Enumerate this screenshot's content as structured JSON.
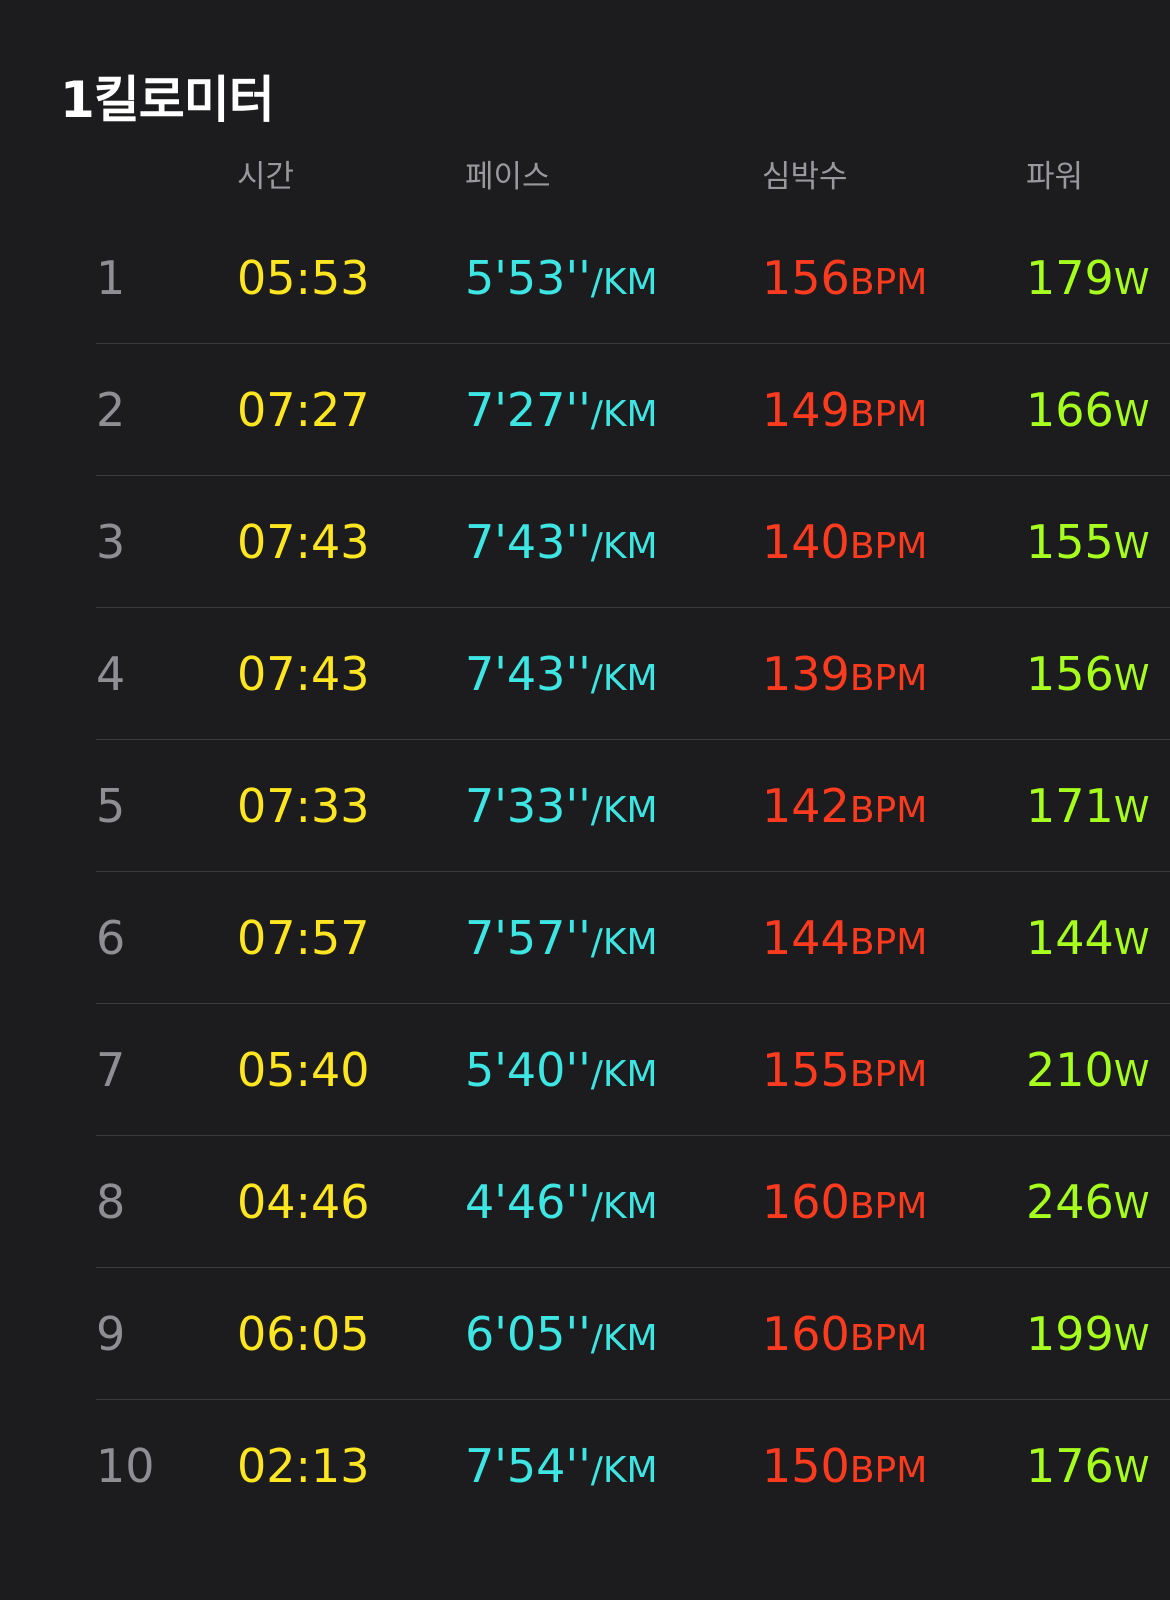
{
  "title": "1킬로미터",
  "headers": {
    "time": "시간",
    "pace": "페이스",
    "heart_rate": "심박수",
    "power": "파워"
  },
  "units": {
    "pace": "/KM",
    "heart_rate": "BPM",
    "power": "W"
  },
  "splits": [
    {
      "index": "1",
      "time": "05:53",
      "pace": "5'53''",
      "heart_rate": "156",
      "power": "179"
    },
    {
      "index": "2",
      "time": "07:27",
      "pace": "7'27''",
      "heart_rate": "149",
      "power": "166"
    },
    {
      "index": "3",
      "time": "07:43",
      "pace": "7'43''",
      "heart_rate": "140",
      "power": "155"
    },
    {
      "index": "4",
      "time": "07:43",
      "pace": "7'43''",
      "heart_rate": "139",
      "power": "156"
    },
    {
      "index": "5",
      "time": "07:33",
      "pace": "7'33''",
      "heart_rate": "142",
      "power": "171"
    },
    {
      "index": "6",
      "time": "07:57",
      "pace": "7'57''",
      "heart_rate": "144",
      "power": "144"
    },
    {
      "index": "7",
      "time": "05:40",
      "pace": "5'40''",
      "heart_rate": "155",
      "power": "210"
    },
    {
      "index": "8",
      "time": "04:46",
      "pace": "4'46''",
      "heart_rate": "160",
      "power": "246"
    },
    {
      "index": "9",
      "time": "06:05",
      "pace": "6'05''",
      "heart_rate": "160",
      "power": "199"
    },
    {
      "index": "10",
      "time": "02:13",
      "pace": "7'54''",
      "heart_rate": "150",
      "power": "176"
    }
  ],
  "colors": {
    "background": "#1c1c1e",
    "index": "#8e8e93",
    "time": "#ffe620",
    "pace": "#3ee6e3",
    "heart_rate": "#ff3b1f",
    "power": "#a6ff1d",
    "header": "#98989d",
    "divider": "#3a3a3c"
  }
}
